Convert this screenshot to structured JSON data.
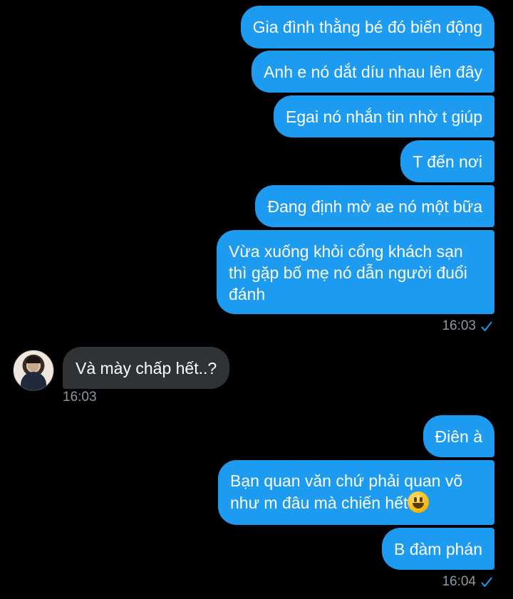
{
  "thread": {
    "group1": [
      "Gia đình thằng bé đó biến động",
      "Anh e nó dắt díu nhau lên đây",
      "Egai nó nhắn tin nhờ t giúp",
      "T đến nơi",
      "Đang định mờ ae nó một bữa",
      "Vừa xuống khỏi cổng khách sạn thì gặp bố mẹ nó dẫn người đuổi đánh"
    ],
    "group1_time": "16:03",
    "incoming": {
      "text": "Và mày chấp hết..?",
      "time": "16:03",
      "avatar_icon": "profile-photo"
    },
    "group2": [
      "Điên à",
      "Bạn quan văn chứ phải quan võ như m đâu mà chiến hết",
      "B đàm phán"
    ],
    "group2_emoji": "grinning-face-emoji",
    "group2_time": "16:04"
  },
  "colors": {
    "outgoing_bubble": "#1d9bf0",
    "incoming_bubble": "#2f3336",
    "background": "#000000",
    "timestamp": "#8b98a5"
  }
}
